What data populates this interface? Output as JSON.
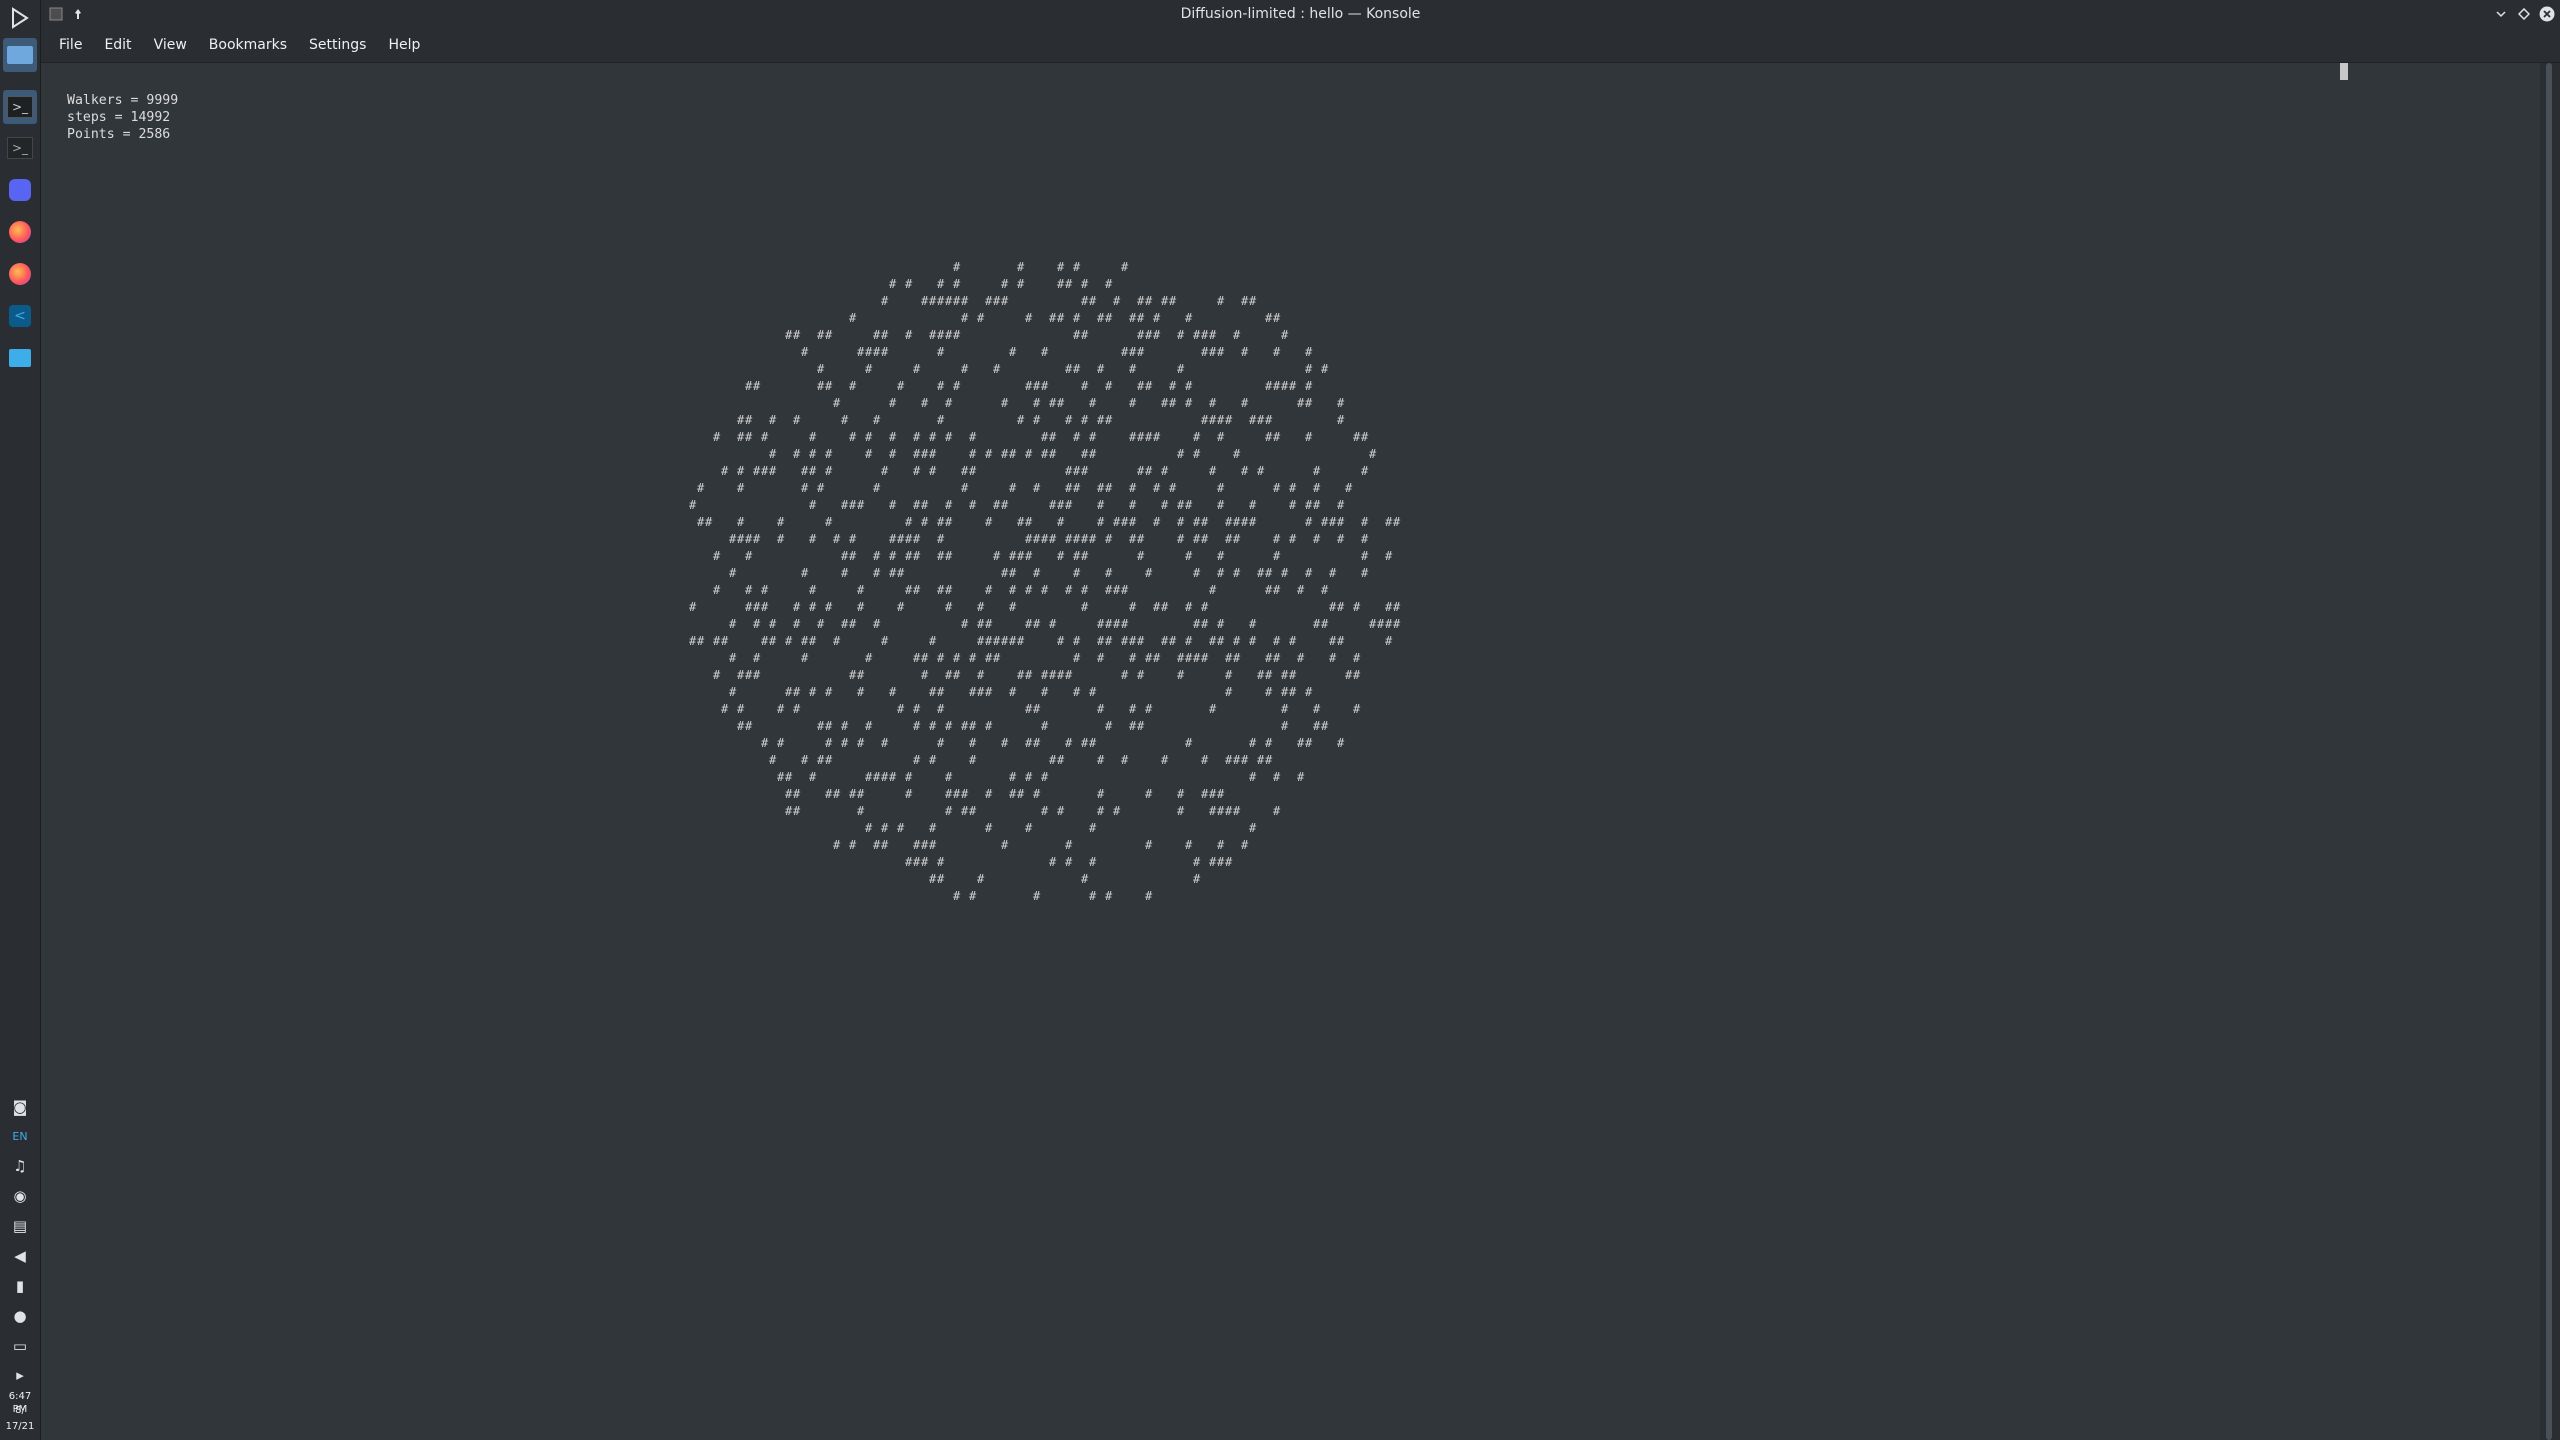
{
  "window": {
    "title": "Diffusion-limited : hello — Konsole"
  },
  "titlebar_buttons": {
    "pin_icon": "pin-icon",
    "menu_icon": "konsole-app-icon",
    "minimize_icon": "chevron-down-icon",
    "maximize_icon": "diamond-icon",
    "close_icon": "close-icon"
  },
  "menubar": {
    "items": [
      "File",
      "Edit",
      "View",
      "Bookmarks",
      "Settings",
      "Help"
    ]
  },
  "terminal": {
    "lines": [
      "Walkers = 9999",
      "steps = 14992",
      "Points = 2586"
    ]
  },
  "panel": {
    "tasks": [
      "desktop",
      "konsole",
      "konsole",
      "discord",
      "firefox",
      "firefox",
      "vscode",
      "files"
    ],
    "tray": [
      "discord-icon",
      "keyboard-layout",
      "notifications-icon",
      "vpn-icon",
      "clipboard-icon",
      "volume-icon",
      "battery-icon",
      "microphone-icon",
      "display-icon",
      "expand-icon"
    ],
    "keyboard_layout": "EN",
    "clock_time": "6:47 PM",
    "clock_date_1": "8/",
    "clock_date_2": "17/21"
  },
  "colors": {
    "background": "#31363b",
    "panel": "#2a2e32",
    "text": "#eff0f1",
    "terminal_text": "#dcdcdc",
    "accent": "#3daee9"
  }
}
